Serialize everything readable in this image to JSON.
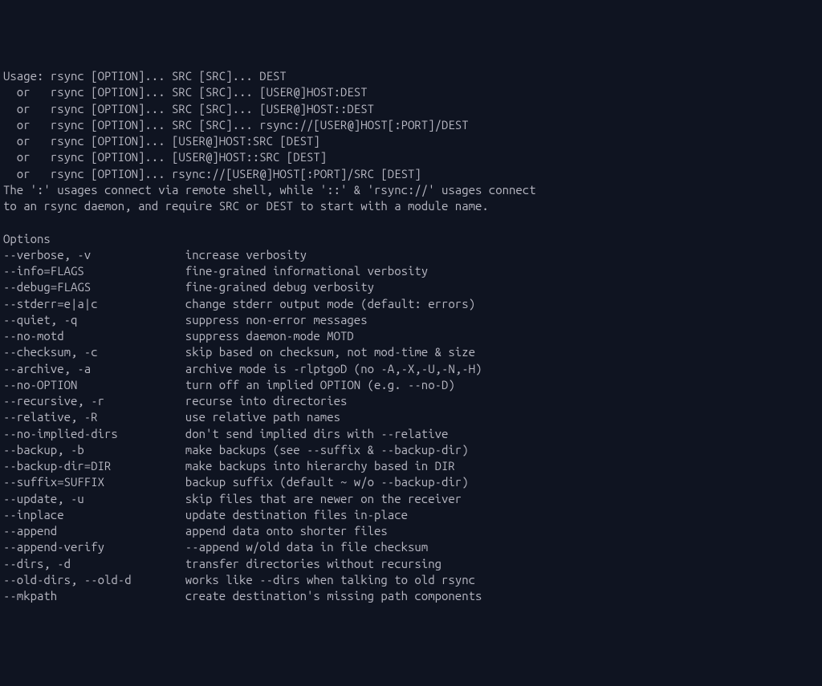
{
  "usage": {
    "lines": [
      "Usage: rsync [OPTION]... SRC [SRC]... DEST",
      "  or   rsync [OPTION]... SRC [SRC]... [USER@]HOST:DEST",
      "  or   rsync [OPTION]... SRC [SRC]... [USER@]HOST::DEST",
      "  or   rsync [OPTION]... SRC [SRC]... rsync://[USER@]HOST[:PORT]/DEST",
      "  or   rsync [OPTION]... [USER@]HOST:SRC [DEST]",
      "  or   rsync [OPTION]... [USER@]HOST::SRC [DEST]",
      "  or   rsync [OPTION]... rsync://[USER@]HOST[:PORT]/SRC [DEST]",
      "The ':' usages connect via remote shell, while '::' & 'rsync://' usages connect",
      "to an rsync daemon, and require SRC or DEST to start with a module name."
    ]
  },
  "options_header": "Options",
  "options": [
    {
      "flag": "--verbose, -v",
      "desc": "increase verbosity"
    },
    {
      "flag": "--info=FLAGS",
      "desc": "fine-grained informational verbosity"
    },
    {
      "flag": "--debug=FLAGS",
      "desc": "fine-grained debug verbosity"
    },
    {
      "flag": "--stderr=e|a|c",
      "desc": "change stderr output mode (default: errors)"
    },
    {
      "flag": "--quiet, -q",
      "desc": "suppress non-error messages"
    },
    {
      "flag": "--no-motd",
      "desc": "suppress daemon-mode MOTD"
    },
    {
      "flag": "--checksum, -c",
      "desc": "skip based on checksum, not mod-time & size"
    },
    {
      "flag": "--archive, -a",
      "desc": "archive mode is -rlptgoD (no -A,-X,-U,-N,-H)"
    },
    {
      "flag": "--no-OPTION",
      "desc": "turn off an implied OPTION (e.g. --no-D)"
    },
    {
      "flag": "--recursive, -r",
      "desc": "recurse into directories"
    },
    {
      "flag": "--relative, -R",
      "desc": "use relative path names"
    },
    {
      "flag": "--no-implied-dirs",
      "desc": "don't send implied dirs with --relative"
    },
    {
      "flag": "--backup, -b",
      "desc": "make backups (see --suffix & --backup-dir)"
    },
    {
      "flag": "--backup-dir=DIR",
      "desc": "make backups into hierarchy based in DIR"
    },
    {
      "flag": "--suffix=SUFFIX",
      "desc": "backup suffix (default ~ w/o --backup-dir)"
    },
    {
      "flag": "--update, -u",
      "desc": "skip files that are newer on the receiver"
    },
    {
      "flag": "--inplace",
      "desc": "update destination files in-place"
    },
    {
      "flag": "--append",
      "desc": "append data onto shorter files"
    },
    {
      "flag": "--append-verify",
      "desc": "--append w/old data in file checksum"
    },
    {
      "flag": "--dirs, -d",
      "desc": "transfer directories without recursing"
    },
    {
      "flag": "--old-dirs, --old-d",
      "desc": "works like --dirs when talking to old rsync"
    },
    {
      "flag": "--mkpath",
      "desc": "create destination's missing path components"
    }
  ]
}
